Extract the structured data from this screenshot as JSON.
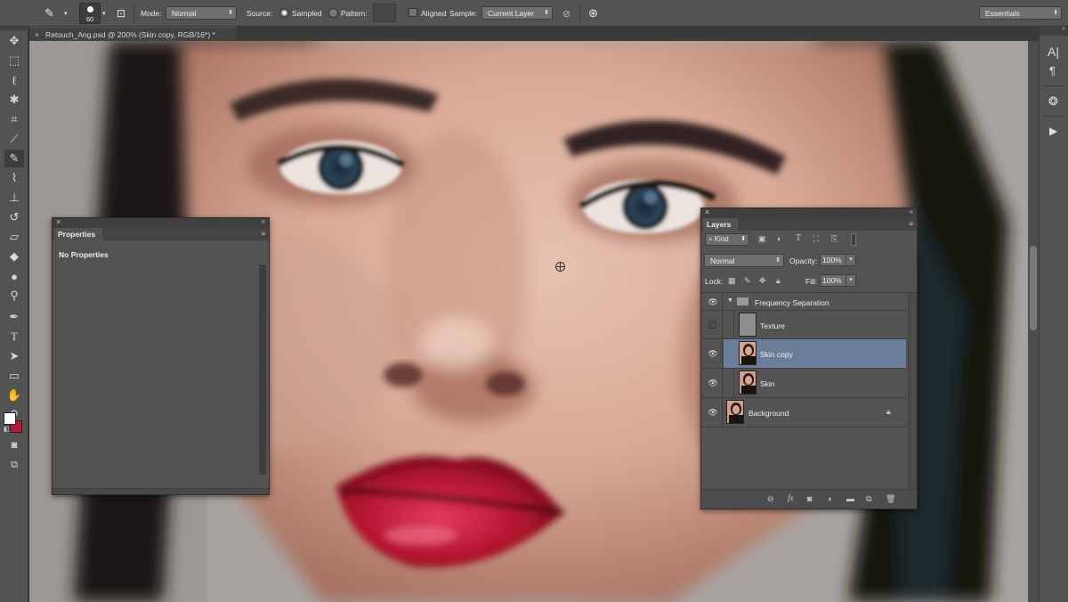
{
  "options_bar": {
    "brush_size": "60",
    "mode_label": "Mode:",
    "mode_value": "Normal",
    "source_label": "Source:",
    "source_sampled": "Sampled",
    "source_pattern": "Pattern:",
    "aligned_label": "Aligned",
    "sample_label": "Sample:",
    "sample_value": "Current Layer",
    "workspace_value": "Essentials"
  },
  "document_tab": {
    "title": "Retouch_Ang.psd @ 200% (Skin copy, RGB/16*) *"
  },
  "properties_panel": {
    "tab_label": "Properties",
    "message": "No Properties"
  },
  "layers_panel": {
    "tab_label": "Layers",
    "filter_kind": "Kind",
    "blend_mode": "Normal",
    "opacity_label": "Opacity:",
    "opacity_value": "100%",
    "lock_label": "Lock:",
    "fill_label": "Fill:",
    "fill_value": "100%",
    "layers": [
      {
        "name": "Frequency Separation",
        "type": "group",
        "visible": true,
        "selected": false
      },
      {
        "name": "Texture",
        "type": "layer",
        "visible": false,
        "selected": false
      },
      {
        "name": "Skin copy",
        "type": "layer",
        "visible": true,
        "selected": true
      },
      {
        "name": "Skin",
        "type": "layer",
        "visible": true,
        "selected": false
      },
      {
        "name": "Background",
        "type": "layer",
        "visible": true,
        "selected": false,
        "locked": true
      }
    ]
  },
  "colors": {
    "foreground": "#ffffff",
    "background": "#b5173b",
    "selected_layer": "#6b7e99",
    "panel_bg": "#535353"
  }
}
